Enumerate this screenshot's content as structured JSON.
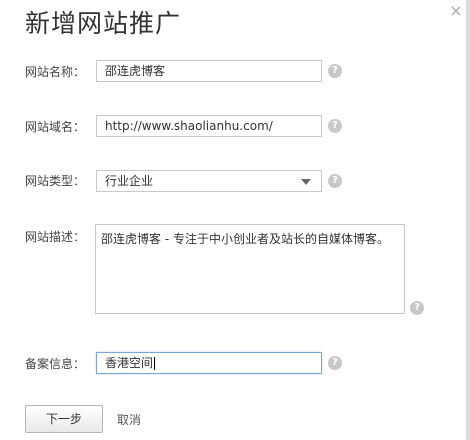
{
  "dialog": {
    "title": "新增网站推广",
    "close_symbol": "×"
  },
  "form": {
    "site_name": {
      "label": "网站名称：",
      "value": "邵连虎博客"
    },
    "site_domain": {
      "label": "网站域名：",
      "value": "http://www.shaolianhu.com/"
    },
    "site_type": {
      "label": "网站类型：",
      "value": "行业企业"
    },
    "site_description": {
      "label": "网站描述：",
      "value": "邵连虎博客 - 专注于中小创业者及站长的自媒体博客。"
    },
    "icp_info": {
      "label": "备案信息：",
      "value": "香港空间"
    },
    "help_symbol": "?"
  },
  "actions": {
    "next_label": "下一步",
    "cancel_label": "取消"
  }
}
